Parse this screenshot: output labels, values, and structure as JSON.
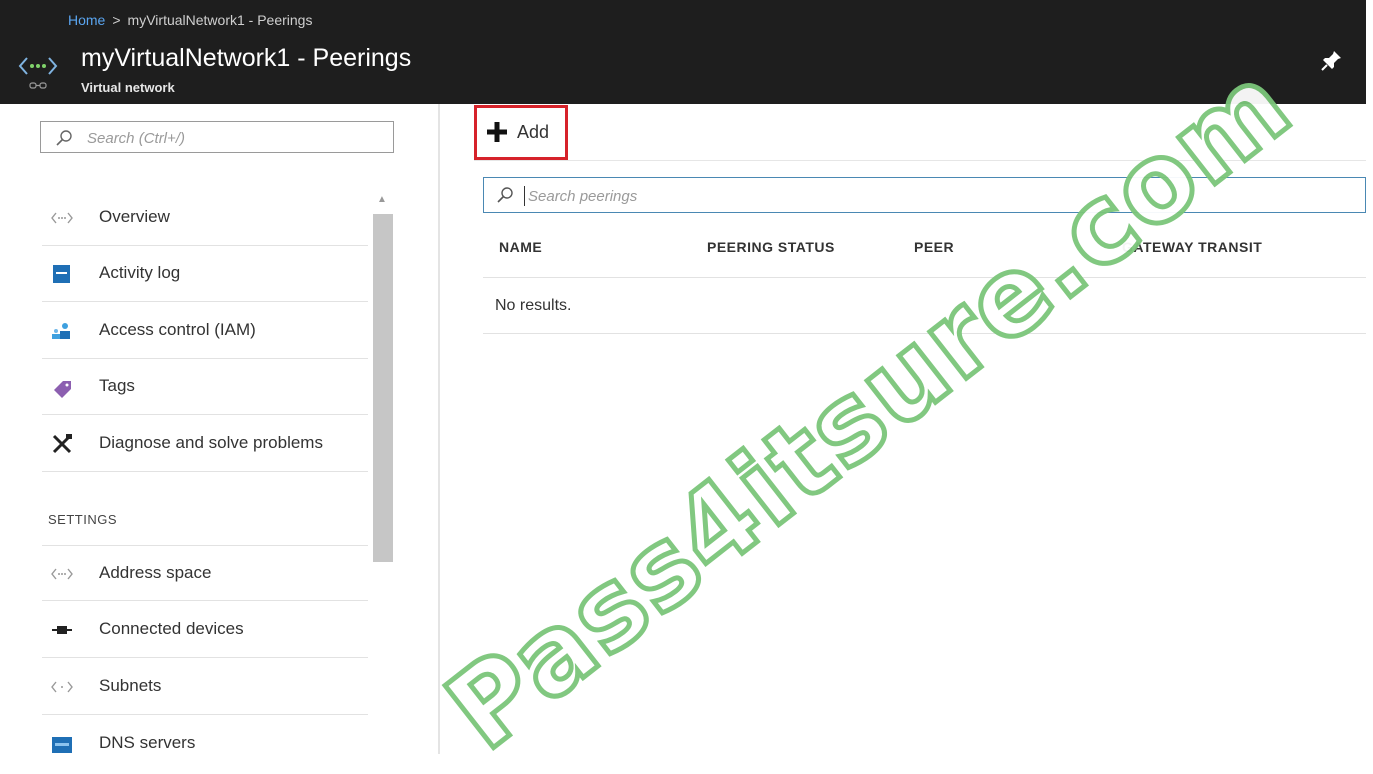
{
  "breadcrumb": {
    "home": "Home",
    "separator": ">",
    "current": "myVirtualNetwork1 - Peerings"
  },
  "blade": {
    "title": "myVirtualNetwork1 - Peerings",
    "subtitle": "Virtual network",
    "icon": "virtual-network-icon"
  },
  "left_menu": {
    "search_placeholder": "Search (Ctrl+/)",
    "items": [
      {
        "label": "Overview",
        "icon": "overview-icon"
      },
      {
        "label": "Activity log",
        "icon": "activity-log-icon"
      },
      {
        "label": "Access control (IAM)",
        "icon": "access-control-icon"
      },
      {
        "label": "Tags",
        "icon": "tag-icon"
      },
      {
        "label": "Diagnose and solve problems",
        "icon": "wrench-icon"
      }
    ],
    "settings_heading": "SETTINGS",
    "settings_items": [
      {
        "label": "Address space",
        "icon": "address-space-icon"
      },
      {
        "label": "Connected devices",
        "icon": "connected-devices-icon"
      },
      {
        "label": "Subnets",
        "icon": "subnets-icon"
      },
      {
        "label": "DNS servers",
        "icon": "dns-servers-icon"
      }
    ]
  },
  "toolbar": {
    "add_label": "Add",
    "highlight_color": "#d6222a"
  },
  "peerings": {
    "search_placeholder": "Search peerings",
    "columns": [
      "NAME",
      "PEERING STATUS",
      "PEER",
      "GATEWAY TRANSIT"
    ],
    "rows": [],
    "empty_text": "No results."
  },
  "watermark": "Pass4itsure.com",
  "colors": {
    "header_bg": "#1e1e1e",
    "link": "#5aa5f0",
    "watermark": "#7bc67a",
    "search_border": "#4a88b3"
  }
}
